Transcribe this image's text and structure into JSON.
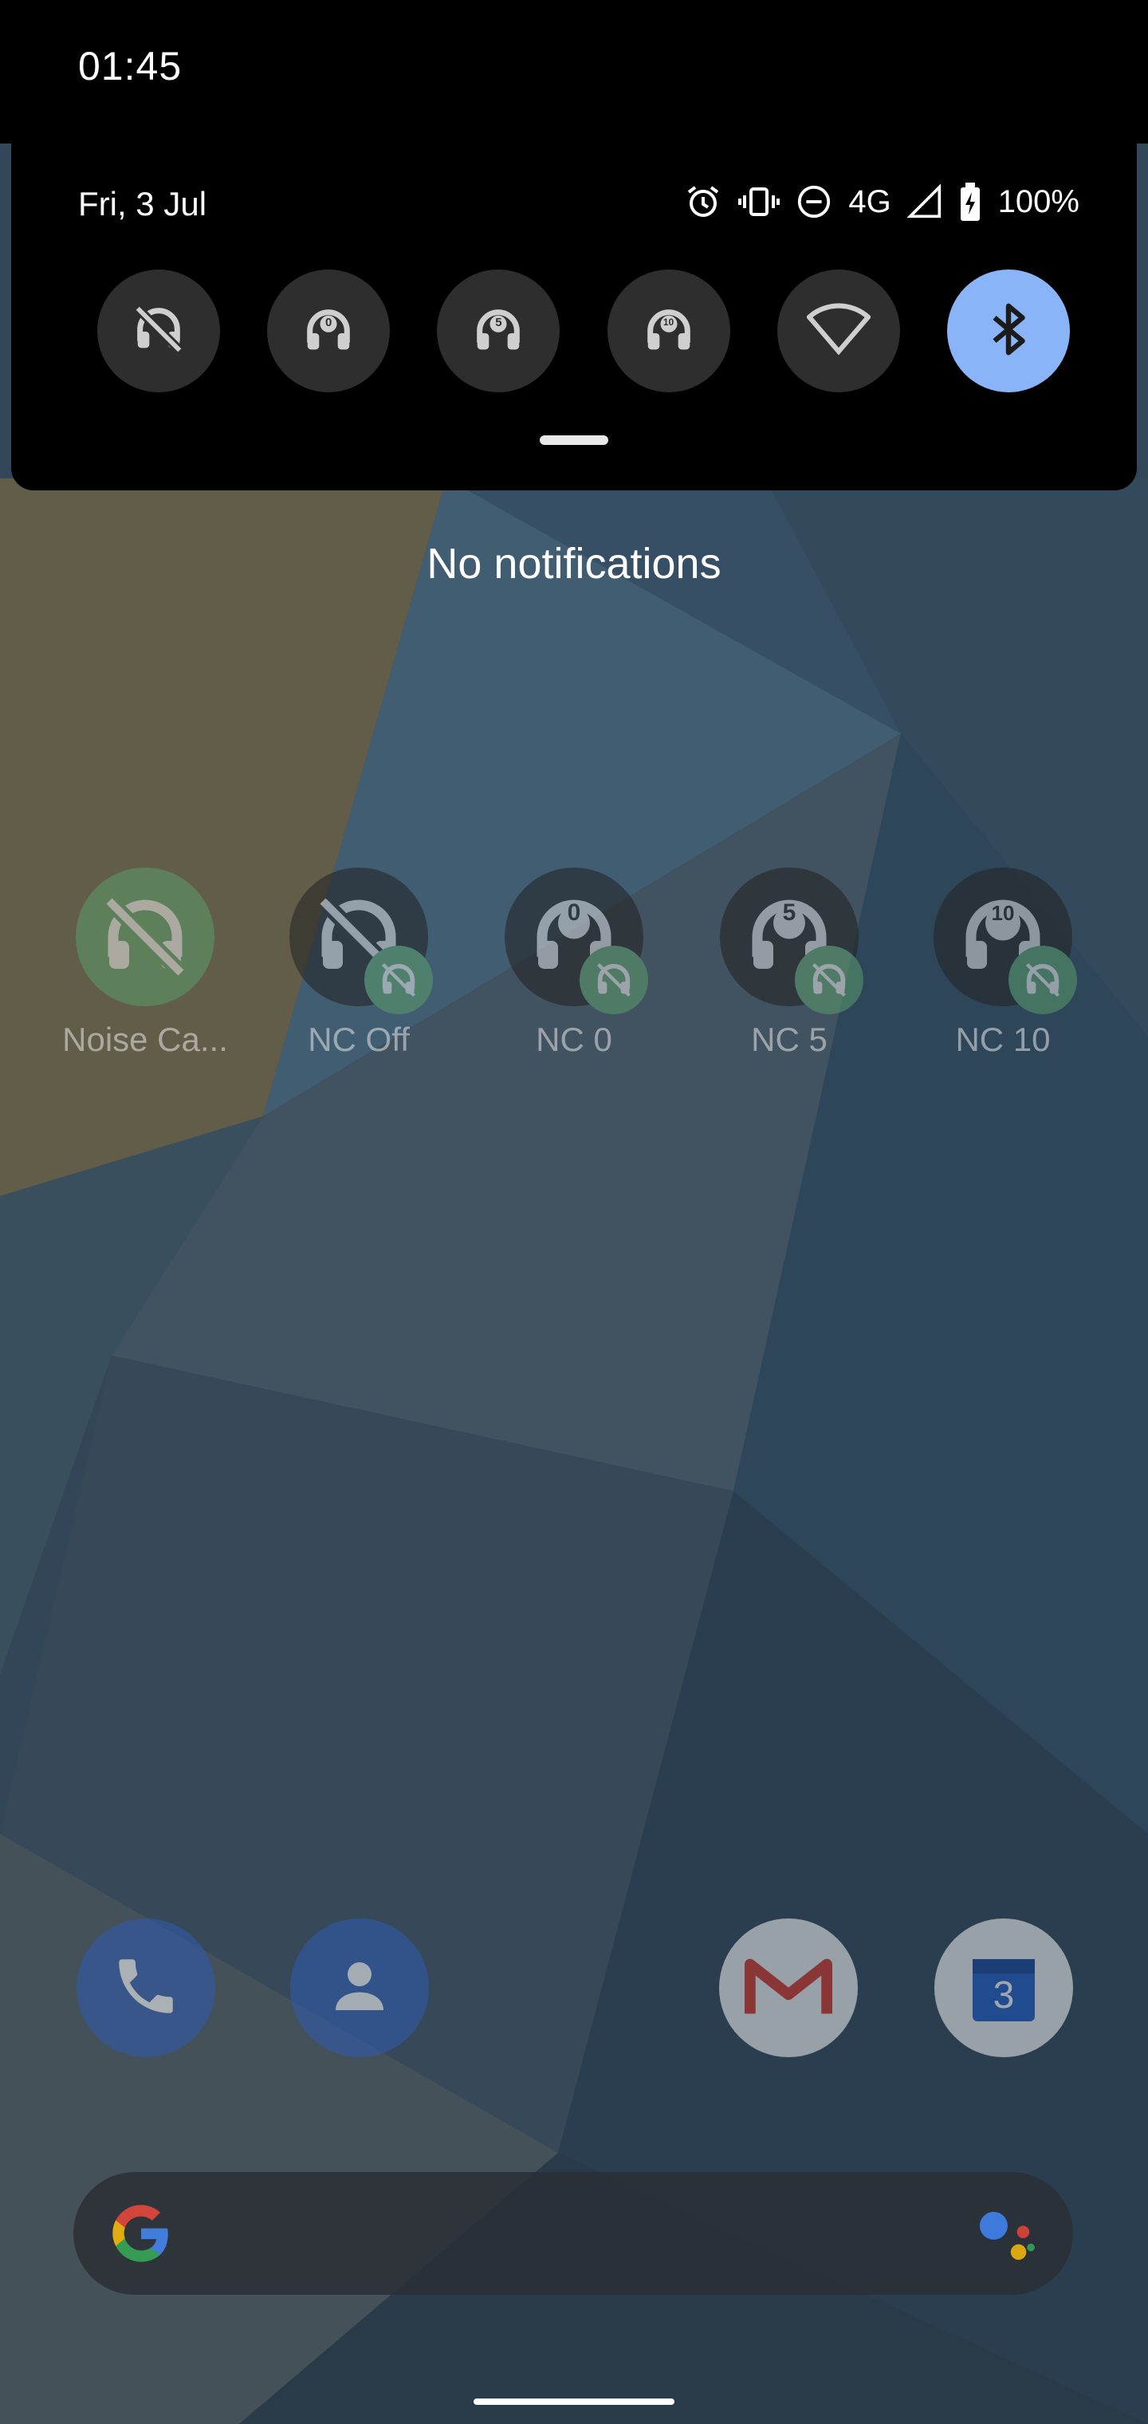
{
  "status_bar": {
    "time": "01:45"
  },
  "quick_settings": {
    "date": "Fri, 3 Jul",
    "network": "4G",
    "battery": "100%",
    "tiles": [
      {
        "name": "nc-off",
        "icon": "headphones-off-icon",
        "label": ""
      },
      {
        "name": "nc-0",
        "icon": "headphones-icon",
        "label": "0"
      },
      {
        "name": "nc-5",
        "icon": "headphones-icon",
        "label": "5"
      },
      {
        "name": "nc-10",
        "icon": "headphones-icon",
        "label": "10"
      },
      {
        "name": "wifi",
        "icon": "wifi-icon",
        "label": ""
      },
      {
        "name": "bluetooth",
        "icon": "bluetooth-icon",
        "label": "",
        "active": true
      }
    ],
    "accent_color": "#8ab4f8"
  },
  "notifications": {
    "empty_text": "No notifications"
  },
  "home": {
    "apps": [
      {
        "label": "Noise Ca...",
        "icon": "headphones-off-icon",
        "badge": ""
      },
      {
        "label": "NC Off",
        "icon": "headphones-off-icon",
        "badge": ""
      },
      {
        "label": "NC 0",
        "icon": "headphones-icon",
        "badge": "0"
      },
      {
        "label": "NC 5",
        "icon": "headphones-icon",
        "badge": "5"
      },
      {
        "label": "NC 10",
        "icon": "headphones-icon",
        "badge": "10"
      }
    ],
    "dock": [
      {
        "name": "phone",
        "icon": "phone-icon"
      },
      {
        "name": "contacts",
        "icon": "contacts-icon"
      },
      {
        "name": "gmail",
        "icon": "gmail-icon"
      },
      {
        "name": "calendar",
        "icon": "calendar-icon",
        "day": "3"
      }
    ]
  }
}
